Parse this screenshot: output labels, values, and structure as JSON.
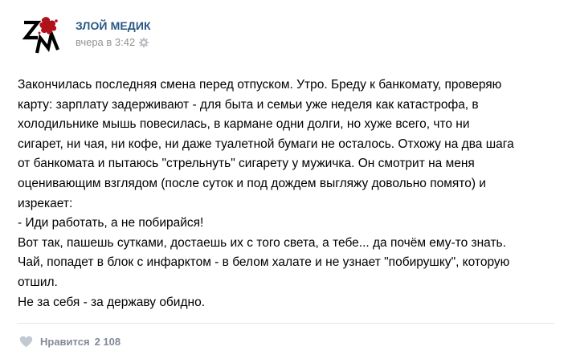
{
  "post": {
    "author": "ЗЛОЙ МЕДИК",
    "time": "вчера в 3:42",
    "avatar_icon": "zm-logo-icon",
    "settings_icon": "gear-icon",
    "lines": [
      "Закончилась последняя смена перед отпуском. Утро. Бреду к банкомату, проверяю",
      "карту: зарплату задерживают - для быта и семьи уже неделя как катастрофа, в",
      "холодильнике мышь повесилась, в кармане одни долги, но хуже всего, что ни",
      "сигарет, ни чая, ни кофе, ни даже туалетной бумаги не осталось. Отхожу на два шага",
      "от банкомата и пытаюсь \"стрельнуть\" сигарету у мужичка. Он смотрит на меня",
      "оценивающим взглядом (после суток и под дождем выгляжу довольно помято) и",
      "изрекает:",
      "- Иди работать, а не побирайся!",
      "Вот так, пашешь сутками, достаешь их с того света, а тебе... да почём ему-то знать.",
      "Чай, попадет в блок с инфарктом - в белом халате и не узнает \"побирушку\", которую",
      "отшил.",
      "Не за себя - за державу обидно."
    ]
  },
  "footer": {
    "like_icon": "heart-icon",
    "like_label": "Нравится",
    "like_count": "2 108"
  },
  "colors": {
    "author": "#2a5885",
    "meta": "#939393",
    "footer": "#828a99",
    "logo_red": "#b0121b"
  }
}
